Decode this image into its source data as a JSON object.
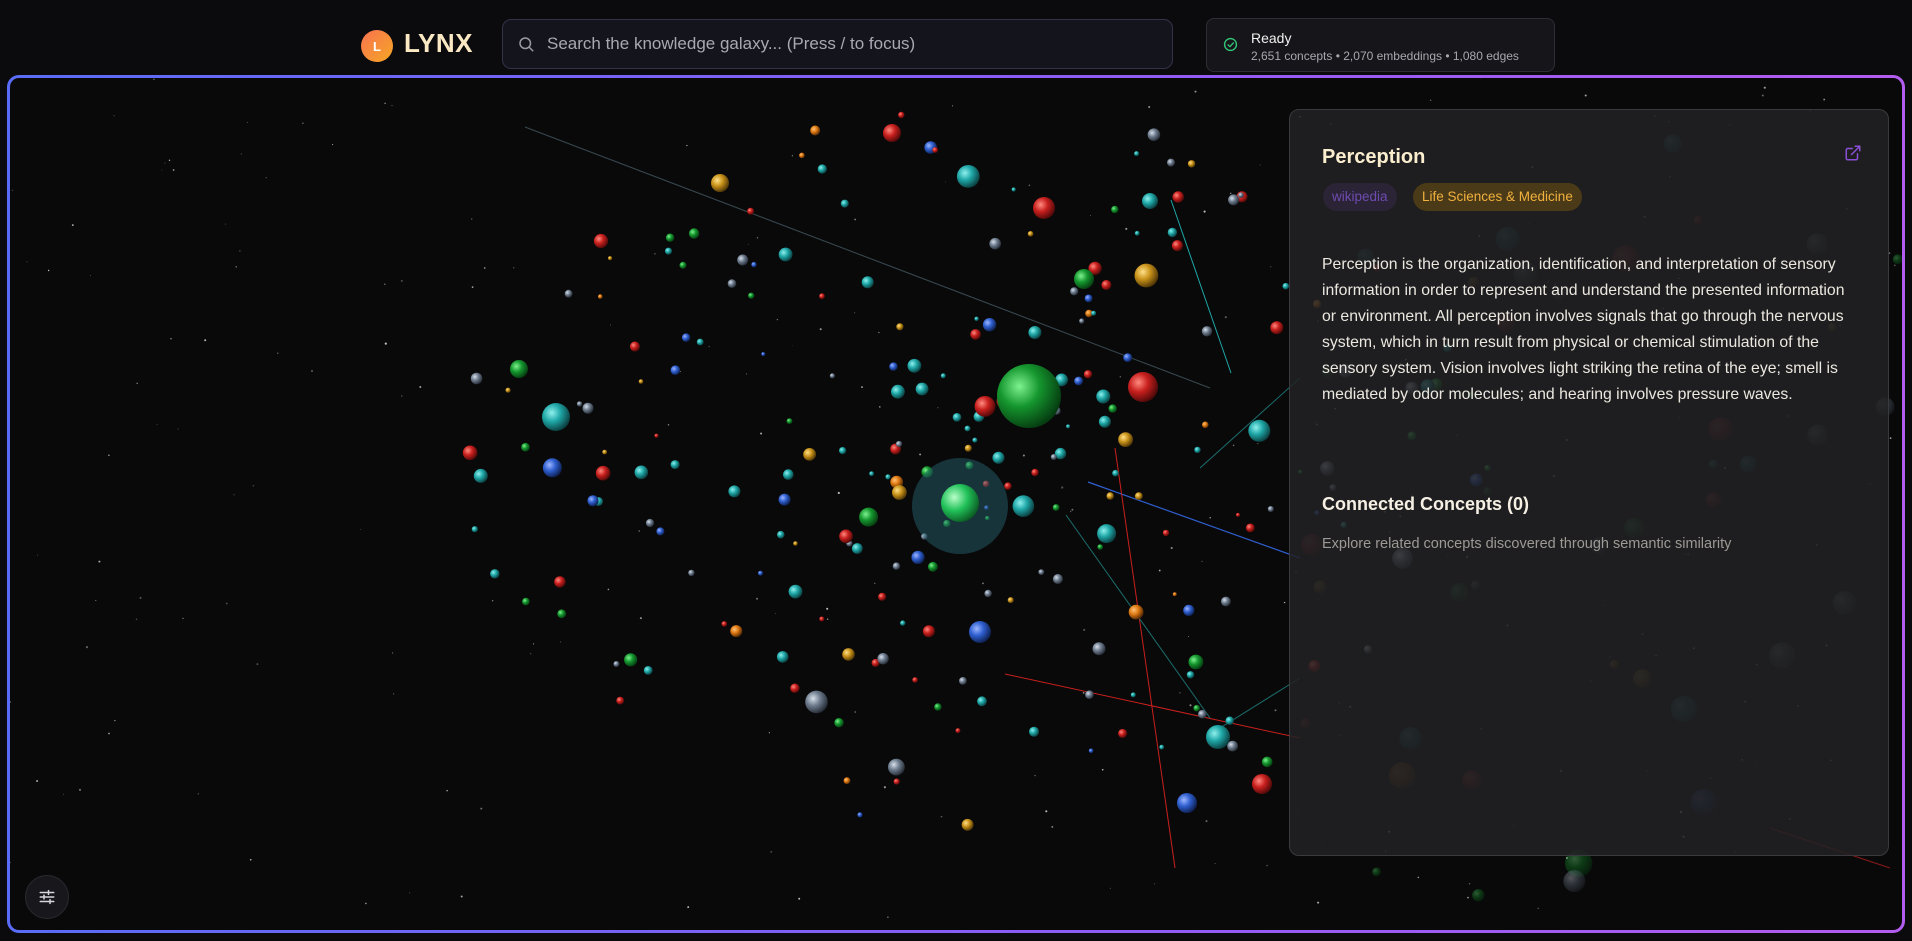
{
  "header": {
    "logo_initial": "L",
    "app_name": "LYNX",
    "search_placeholder": "Search the knowledge galaxy... (Press / to focus)",
    "status": {
      "title": "Ready",
      "summary": "2,651 concepts • 2,070 embeddings • 1,080 edges"
    }
  },
  "detail_panel": {
    "title": "Perception",
    "source_tag": "wikipedia",
    "category_tag": "Life Sciences & Medicine",
    "description": "Perception is the organization, identification, and interpretation of sensory information in order to represent and understand the presented information or environment. All perception involves signals that go through the nervous system, which in turn result from physical or chemical stimulation of the sensory system. Vision involves light striking the retina of the eye; smell is mediated by odor molecules; and hearing involves pressure waves.",
    "connected_title": "Connected Concepts (0)",
    "connected_subtitle": "Explore related concepts discovered through semantic similarity"
  },
  "icons": {
    "search": "search-icon",
    "status": "check-circle-icon",
    "external": "external-link-icon",
    "settings": "sliders-icon"
  },
  "colors": {
    "accent_gradient": [
      "#5a6cf7",
      "#b35cf0"
    ],
    "category": "#f2b13d",
    "source": "#6f4bb0",
    "status_ok": "#34c97a",
    "node_palette": [
      "#1fa7a7",
      "#c9201e",
      "#15962e",
      "#6f7d8f",
      "#c9931a",
      "#2f5fd0",
      "#e07a12"
    ]
  }
}
